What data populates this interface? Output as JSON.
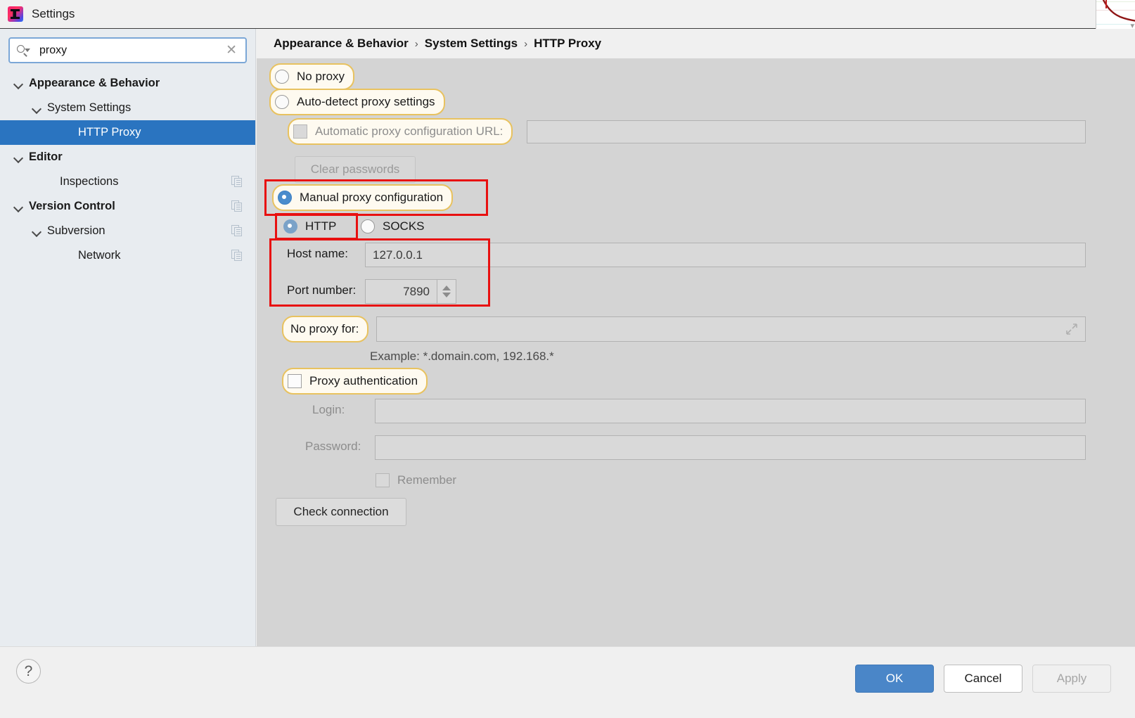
{
  "window": {
    "title": "Settings",
    "logo_icon": "intellij-idea-logo"
  },
  "search": {
    "value": "proxy",
    "placeholder": "Search settings",
    "search_icon": "search-icon",
    "clear_icon": "close-icon",
    "clear_glyph": "✕"
  },
  "sidebar": {
    "items": [
      {
        "label": "Appearance & Behavior",
        "indent": 18,
        "bold": true,
        "expandable": true,
        "selected": false,
        "copy_icon": false
      },
      {
        "label": "System Settings",
        "indent": 44,
        "bold": false,
        "expandable": true,
        "selected": false,
        "copy_icon": false
      },
      {
        "label": "HTTP Proxy",
        "indent": 88,
        "bold": false,
        "expandable": false,
        "selected": true,
        "copy_icon": false
      },
      {
        "label": "Editor",
        "indent": 18,
        "bold": true,
        "expandable": true,
        "selected": false,
        "copy_icon": false
      },
      {
        "label": "Inspections",
        "indent": 62,
        "bold": false,
        "expandable": false,
        "selected": false,
        "copy_icon": true
      },
      {
        "label": "Version Control",
        "indent": 18,
        "bold": true,
        "expandable": true,
        "selected": false,
        "copy_icon": true
      },
      {
        "label": "Subversion",
        "indent": 44,
        "bold": false,
        "expandable": true,
        "selected": false,
        "copy_icon": true
      },
      {
        "label": "Network",
        "indent": 88,
        "bold": false,
        "expandable": false,
        "selected": false,
        "copy_icon": true
      }
    ]
  },
  "breadcrumb": {
    "parts": [
      "Appearance & Behavior",
      "System Settings",
      "HTTP Proxy"
    ],
    "separator": "›"
  },
  "main": {
    "no_proxy": {
      "label": "No proxy",
      "checked": false,
      "highlighted": true
    },
    "auto_detect": {
      "label": "Auto-detect proxy settings",
      "checked": false,
      "highlighted": true
    },
    "auto_config_url": {
      "label": "Automatic proxy configuration URL:",
      "checked": false,
      "disabled": true,
      "highlighted": true,
      "value": ""
    },
    "clear_passwords": {
      "label": "Clear passwords",
      "disabled": true
    },
    "manual_proxy": {
      "label": "Manual proxy configuration",
      "checked": true,
      "highlighted": true,
      "annotated": true
    },
    "protocol_http": {
      "label": "HTTP",
      "checked": true,
      "annotated": true
    },
    "protocol_socks": {
      "label": "SOCKS",
      "checked": false,
      "annotated": false
    },
    "host_name": {
      "label": "Host name:",
      "value": "127.0.0.1"
    },
    "port_number": {
      "label": "Port number:",
      "value": "7890",
      "spinner_up_icon": "chevron-up-icon",
      "spinner_down_icon": "chevron-down-icon"
    },
    "no_proxy_for": {
      "label": "No proxy for:",
      "value": "",
      "highlighted": true,
      "expand_icon": "expand-icon"
    },
    "example": "Example: *.domain.com, 192.168.*",
    "proxy_authentication": {
      "label": "Proxy authentication",
      "checked": false,
      "highlighted": true
    },
    "login": {
      "label": "Login:",
      "value": "",
      "disabled": true
    },
    "password": {
      "label": "Password:",
      "value": "",
      "disabled": true
    },
    "remember": {
      "label": "Remember",
      "checked": false,
      "disabled": true
    },
    "check_connection": {
      "label": "Check connection",
      "disabled": false
    }
  },
  "footer": {
    "help_label": "?",
    "ok": {
      "label": "OK",
      "style": "primary"
    },
    "cancel": {
      "label": "Cancel",
      "style": "normal"
    },
    "apply": {
      "label": "Apply",
      "style": "disabled"
    }
  },
  "colors": {
    "selection_blue": "#2a74c0",
    "primary_button": "#4a86c8",
    "highlight_yellow": "#e8c25f",
    "annotation_red": "#e81010",
    "panel_gray": "#d4d4d4",
    "sidebar_gray": "#e8ecf0"
  }
}
